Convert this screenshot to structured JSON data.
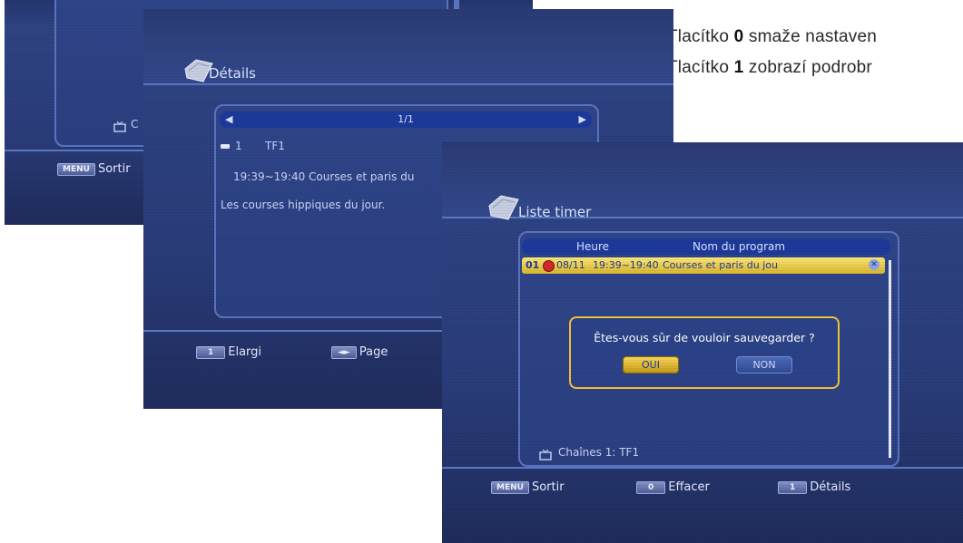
{
  "manual": {
    "line1": {
      "prefix": "Tlacítko ",
      "key": "0",
      "suffix": " smaže nastaven"
    },
    "line2": {
      "prefix": "Tlacítko ",
      "key": "1",
      "suffix": " zobrazí podrobr"
    }
  },
  "screen_back": {
    "channel_fragment": "C",
    "footer": {
      "key": "MENU",
      "label": "Sortir"
    }
  },
  "screen_details": {
    "title": "Détails",
    "pager": "1/1",
    "channel_number": "1",
    "channel_name": "TF1",
    "event_line": "19:39~19:40 Courses et paris du",
    "description": "Les courses hippiques du jour.",
    "footer": [
      {
        "key": "1",
        "label": "Elargi"
      },
      {
        "key": "◄►",
        "label": "Page"
      }
    ]
  },
  "screen_timer": {
    "title": "Liste timer",
    "columns": {
      "time": "Heure",
      "program": "Nom du program"
    },
    "row": {
      "index": "01",
      "date": "08/11",
      "time": "19:39~19:40",
      "program": "Courses et paris du jou"
    },
    "dialog": {
      "question": "Êtes-vous sûr de vouloir sauvegarder ?",
      "yes": "OUI",
      "no": "NON"
    },
    "channel_label": "Chaînes 1: TF1",
    "footer": [
      {
        "key": "MENU",
        "label": "Sortir"
      },
      {
        "key": "0",
        "label": "Effacer"
      },
      {
        "key": "1",
        "label": "Détails"
      }
    ]
  },
  "colors": {
    "accent_blue": "#1d3a9a",
    "selection_yellow": "#f2d64a",
    "dialog_border": "#f0c43a",
    "record_red": "#d22a2a"
  }
}
